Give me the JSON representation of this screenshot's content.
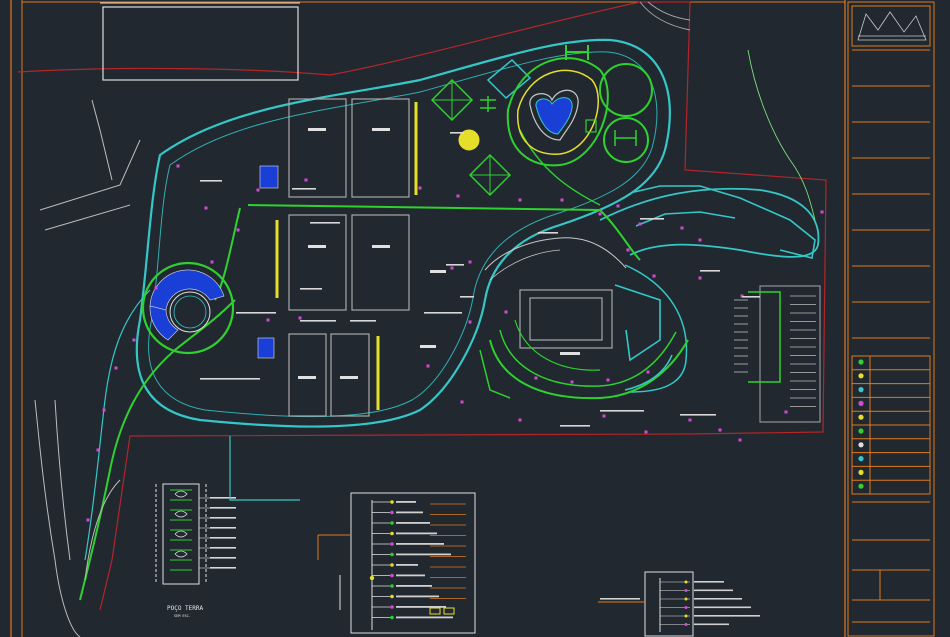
{
  "app": {
    "title": "",
    "background": "#212830"
  },
  "colors": {
    "frame": "#e07a1a",
    "boundary": "#b3262a",
    "road_cyan": "#35c7c7",
    "road_green": "#2fd12f",
    "light_green": "#7be07b",
    "pool_blue": "#1a3fd6",
    "yellow": "#e6df2a",
    "magenta": "#d24bd2",
    "white": "#e6e6e6",
    "gray": "#a8a8a8"
  },
  "drawing": {
    "detail_title": "POÇO TERRA",
    "detail_subtitle": "SEM ESC."
  },
  "title_block": {
    "rows": 8,
    "legend_rows": 10
  }
}
